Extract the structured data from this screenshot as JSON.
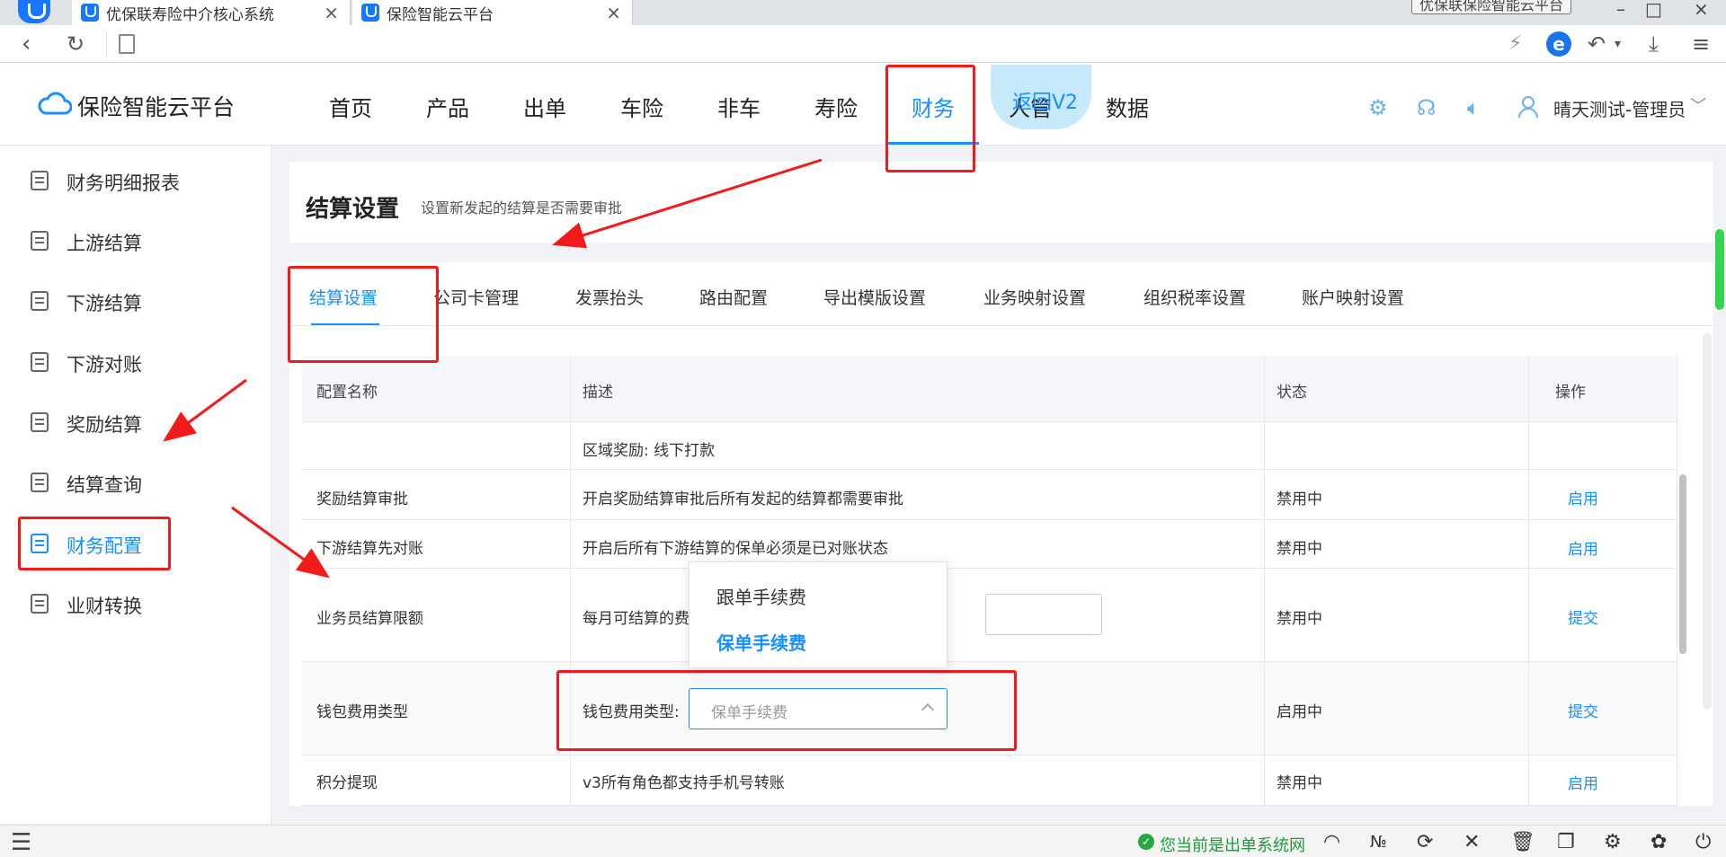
{
  "browser": {
    "tabs": [
      {
        "title": "优保联寿险中介核心系统"
      },
      {
        "title": "保险智能云平台"
      }
    ],
    "window_title": "优保联保险智能云平台"
  },
  "header": {
    "brand": "保险智能云平台",
    "nav": [
      "首页",
      "产品",
      "出单",
      "车险",
      "非车",
      "寿险",
      "财务",
      "人管",
      "数据"
    ],
    "active_nav": "财务",
    "back_v2": "返回V2",
    "user": "晴天测试-管理员"
  },
  "sidebar": {
    "items": [
      {
        "label": "财务明细报表"
      },
      {
        "label": "上游结算"
      },
      {
        "label": "下游结算"
      },
      {
        "label": "下游对账"
      },
      {
        "label": "奖励结算"
      },
      {
        "label": "结算查询"
      },
      {
        "label": "财务配置"
      },
      {
        "label": "业财转换"
      }
    ],
    "active": "财务配置"
  },
  "page": {
    "title": "结算设置",
    "subtitle": "设置新发起的结算是否需要审批"
  },
  "tabs": [
    "结算设置",
    "公司卡管理",
    "发票抬头",
    "路由配置",
    "导出模版设置",
    "业务映射设置",
    "组织税率设置",
    "账户映射设置"
  ],
  "table": {
    "headers": [
      "配置名称",
      "描述",
      "状态",
      "操作"
    ],
    "rows": [
      {
        "name": "",
        "desc": "区域奖励: 线下打款",
        "status": "",
        "action": ""
      },
      {
        "name": "奖励结算审批",
        "desc": "开启奖励结算审批后所有发起的结算都需要审批",
        "status": "禁用中",
        "action": "启用"
      },
      {
        "name": "下游结算先对账",
        "desc": "开启后所有下游结算的保单必须是已对账状态",
        "status": "禁用中",
        "action": "启用"
      },
      {
        "name": "业务员结算限额",
        "desc": "每月可结算的费",
        "status": "禁用中",
        "action": "提交"
      },
      {
        "name": "钱包费用类型",
        "desc": "钱包费用类型:",
        "status": "启用中",
        "action": "提交",
        "select_value": "保单手续费"
      },
      {
        "name": "积分提现",
        "desc": "v3所有角色都支持手机号转账",
        "status": "禁用中",
        "action": "启用"
      }
    ]
  },
  "dropdown": {
    "options": [
      "跟单手续费",
      "保单手续费"
    ],
    "selected": "保单手续费"
  },
  "statusbar": {
    "text": "您当前是出单系统网"
  },
  "colors": {
    "primary": "#1890ff",
    "annotation": "#f21a1a",
    "status_ok": "#1a9a3b"
  }
}
